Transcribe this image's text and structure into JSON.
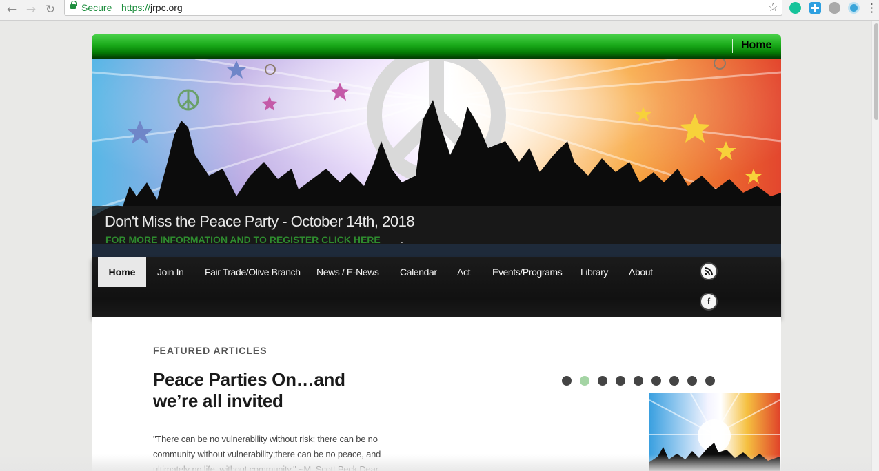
{
  "browser": {
    "secure_label": "Secure",
    "url_scheme": "https://",
    "url_host": "jrpc.org",
    "extensions": [
      "grammarly-icon",
      "plus-icon",
      "ghostery-icon",
      "colorpick-icon"
    ]
  },
  "top_bar": {
    "home_label": "Home"
  },
  "hero": {
    "title": "Don't Miss the Peace Party - October 14th, 2018",
    "link_text": "FOR MORE INFORMATION AND TO REGISTER CLICK HERE",
    "link_suffix": "."
  },
  "nav": {
    "items": [
      {
        "label": "Home",
        "active": true
      },
      {
        "label": "Join In"
      },
      {
        "label": "Fair Trade/Olive Branch"
      },
      {
        "label": "News / E-News"
      },
      {
        "label": "Calendar"
      },
      {
        "label": "Act"
      },
      {
        "label": "Events/Programs"
      },
      {
        "label": "Library"
      },
      {
        "label": "About"
      }
    ],
    "social": {
      "rss_icon": "rss-icon",
      "facebook_glyph": "f"
    }
  },
  "featured": {
    "section_label": "FEATURED ARTICLES",
    "title": "Peace Parties On…and we’re all invited",
    "excerpt": "\"There can be no vulnerability without risk; there can be no community without vulnerability;there can be no peace, and ultimately no life, without community.\" ~M. Scott Peck Dear Peace",
    "slider_dot_count": 9,
    "active_dot_index": 1
  },
  "colors": {
    "green_bar": "#19a919",
    "link_green": "#2e8b2e",
    "nav_bg": "#111111",
    "active_dot": "#a4d4a4",
    "secure_green": "#1e8e3e"
  }
}
